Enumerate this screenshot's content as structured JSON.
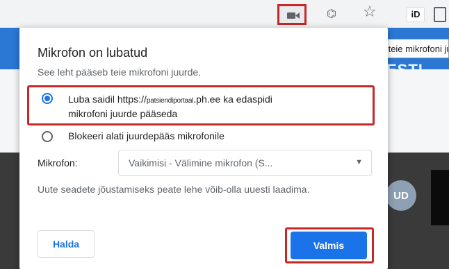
{
  "toolbar": {
    "camera_icon": "video-camera-icon",
    "translate_icon": "translate-icon",
    "star_icon": "star-icon",
    "extension_label": "iD"
  },
  "page": {
    "title_fragment": "ESTI",
    "avatar_initials": "UD"
  },
  "tooltip": {
    "text": "See leht pääseb teie mikrofoni juurde."
  },
  "popup": {
    "title": "Mikrofon on lubatud",
    "subtitle": "See leht pääseb teie mikrofoni juurde.",
    "option_allow": {
      "prefix": "Luba saidil https://",
      "url_host": "patsiendiportaal",
      "suffix_line1": ".ph.ee ka edaspidi",
      "line2": "mikrofoni juurde pääseda",
      "selected": true
    },
    "option_block": {
      "label": "Blokeeri alati juurdepääs mikrofonile",
      "selected": false
    },
    "microphone": {
      "label": "Mikrofon:",
      "selected_value": "Vaikimisi - Välimine mikrofon (S..."
    },
    "notice": "Uute seadete jõustamiseks peate lehe võib-olla uuesti laadima.",
    "manage_button": "Halda",
    "done_button": "Valmis"
  },
  "colors": {
    "accent": "#1a73e8",
    "highlight": "#c62828",
    "page_header": "#2a78d3"
  }
}
